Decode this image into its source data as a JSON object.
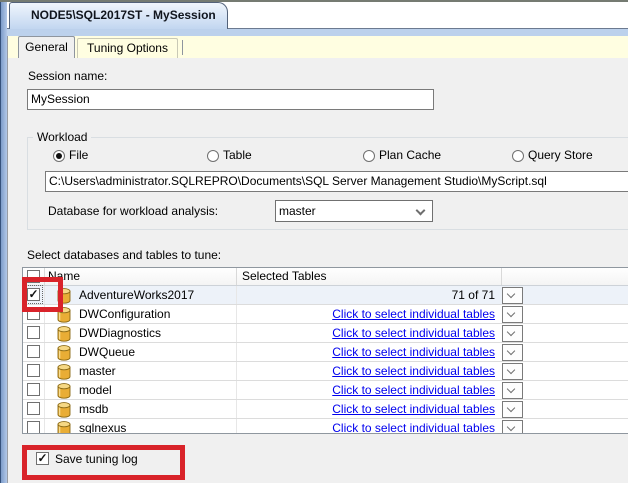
{
  "document_tab": {
    "title": "NODE5\\SQL2017ST - MySession"
  },
  "tabs": [
    {
      "label": "General",
      "selected": true
    },
    {
      "label": "Tuning Options",
      "selected": false
    }
  ],
  "session": {
    "label": "Session name:",
    "value": "MySession"
  },
  "workload": {
    "legend": "Workload",
    "options": [
      {
        "label": "File",
        "selected": true
      },
      {
        "label": "Table",
        "selected": false
      },
      {
        "label": "Plan Cache",
        "selected": false
      },
      {
        "label": "Query Store",
        "selected": false
      }
    ],
    "file_path": "C:\\Users\\administrator.SQLREPRO\\Documents\\SQL Server Management Studio\\MyScript.sql",
    "database_label": "Database for workload analysis:",
    "database_value": "master"
  },
  "tables_section": {
    "label": "Select databases and tables to tune:",
    "columns": [
      "Name",
      "Selected Tables"
    ],
    "header_checkbox_checked": false,
    "rows": [
      {
        "name": "AdventureWorks2017",
        "checked": true,
        "selected_tables": "71 of 71",
        "is_link": false
      },
      {
        "name": "DWConfiguration",
        "checked": false,
        "selected_tables": "Click to select individual tables",
        "is_link": true
      },
      {
        "name": "DWDiagnostics",
        "checked": false,
        "selected_tables": "Click to select individual tables",
        "is_link": true
      },
      {
        "name": "DWQueue",
        "checked": false,
        "selected_tables": "Click to select individual tables",
        "is_link": true
      },
      {
        "name": "master",
        "checked": false,
        "selected_tables": "Click to select individual tables",
        "is_link": true
      },
      {
        "name": "model",
        "checked": false,
        "selected_tables": "Click to select individual tables",
        "is_link": true
      },
      {
        "name": "msdb",
        "checked": false,
        "selected_tables": "Click to select individual tables",
        "is_link": true
      },
      {
        "name": "sqlnexus",
        "checked": false,
        "selected_tables": "Click to select individual tables",
        "is_link": true
      }
    ]
  },
  "footer": {
    "save_label": "Save tuning log",
    "checked": true
  },
  "colors": {
    "annotation_red": "#d9232a",
    "link_blue": "#0000ee",
    "tab_strip_yellow": "#fffee1",
    "doc_tab_blue": "#c2d6f0",
    "content_gray": "#f0f0f0",
    "first_row_bg": "#edf2f9"
  },
  "icons": {
    "database_icon": "cylinder",
    "check_glyph": "✓",
    "chevron_down": "⌄"
  }
}
